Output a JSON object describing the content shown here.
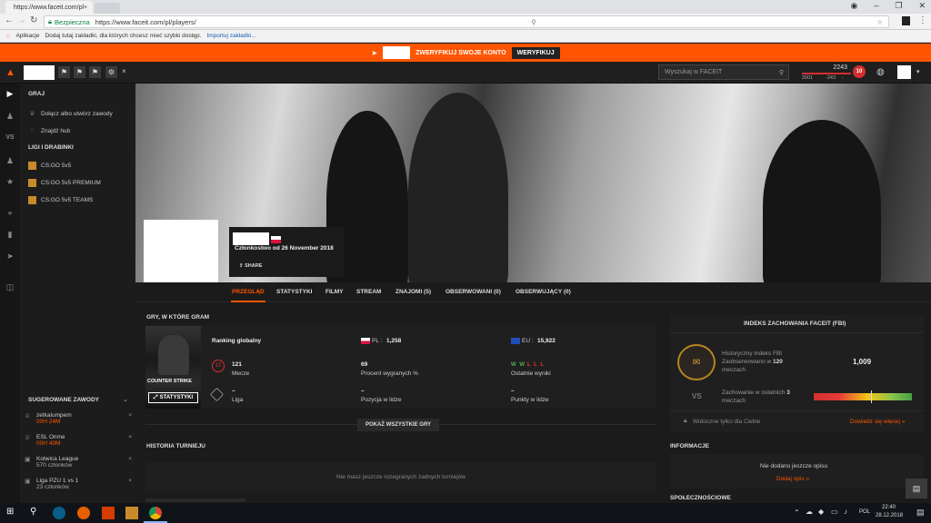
{
  "browser": {
    "tab_title": "https://www.faceit.com/pl",
    "tab_close": "×",
    "security": "Bezpieczna",
    "url": "https://www.faceit.com/pl/players/",
    "bookmarks_apps": "Aplikacje",
    "bookmarks_hint": "Dodaj tutaj zakładki, dla których chcesz mieć szybki dostęp.",
    "bookmarks_import": "Importuj zakładki..."
  },
  "banner": {
    "text": "ZWERYFIKUJ SWOJE KONTO",
    "button": "WERYFIKUJ"
  },
  "header": {
    "search_placeholder": "Wyszukaj w FACEIT",
    "elo_value": "2243",
    "elo_low": "2001",
    "elo_mid": "-243",
    "elo_high": "-",
    "level": "10",
    "close": "×"
  },
  "sidebar": {
    "play_title": "GRAJ",
    "join_label": "Dołącz albo utwórz zawody",
    "find_hub": "Znajdź hub",
    "ligues_title": "LIGI I DRABINKI",
    "ladders": [
      "CS:GO 5v5",
      "CS:GO 5v5 PREMIUM",
      "CS:GO 5v5 TEAMS"
    ],
    "suggested_title": "SUGEROWANE ZAWODY",
    "suggested": [
      {
        "name": "zetkalumpem",
        "sub": "00H 24M",
        "sub_color": "#ff5500"
      },
      {
        "name": "ESL Onme",
        "sub": "00H 40M",
        "sub_color": "#ff5500"
      },
      {
        "name": "Kotwica League",
        "sub": "570 członków",
        "sub_color": "#aaaaaa"
      },
      {
        "name": "Liga PZU 1 vs 1",
        "sub": "23 członków",
        "sub_color": "#aaaaaa"
      }
    ]
  },
  "profile": {
    "member_since": "Członkostwo od 26 November 2018",
    "share": "SHARE"
  },
  "tabs": [
    "PRZEGLĄD",
    "STATYSTYKI",
    "FILMY",
    "STREAM",
    "ZNAJOMI (5)",
    "OBSERWOWANI (0)",
    "OBSERWUJĄCY (0)"
  ],
  "games": {
    "title": "GRY, W KTÓRE GRAM",
    "cover_title": "COUNTER STRIKE",
    "stats_button": "STATYSTYKI",
    "ranking_label": "Ranking globalny",
    "pl_label": "PL :",
    "pl_value": "1,258",
    "eu_label": "EU :",
    "eu_value": "15,922",
    "matches_value": "121",
    "matches_label": "Mecze",
    "winrate_value": "69",
    "winrate_label": "Procent wygranych %",
    "recent_w": "W W",
    "recent_l": "L L L",
    "recent_label": "Ostatnie wyniki",
    "league_value": "–",
    "league_label": "Liga",
    "position_value": "–",
    "position_label": "Pozycja w lidze",
    "points_value": "–",
    "points_label": "Punkty w lidze",
    "show_all": "POKAŻ WSZYSTKIE GRY"
  },
  "history": {
    "title": "HISTORIA TURNIEJU",
    "empty": "Nie masz jeszcze rozegranych żadnych turniejów"
  },
  "fbi": {
    "title": "INDEKS ZACHOWANIA FACEIT (FBI)",
    "hist_line1": "Historyczny indeks FBI",
    "hist_line2": "Zaobserwowano w",
    "hist_count": "120",
    "hist_line3": "meczach",
    "score": "1,009",
    "vs": "VS",
    "recent_line1": "Zachowanie w ostatnich",
    "recent_count": "3",
    "recent_line2": "meczach",
    "private": "Widoczne tylko dla Ciebie",
    "more": "Dowiedz się więcej »"
  },
  "info": {
    "title": "INFORMACJE",
    "no_desc": "Nie dodano jeszcze opisu",
    "add": "Dodaj opis »",
    "social": "SPOŁECZNOŚCIOWE"
  },
  "taskbar": {
    "lang": "POL",
    "time": "22:40",
    "date": "28.12.2018"
  }
}
